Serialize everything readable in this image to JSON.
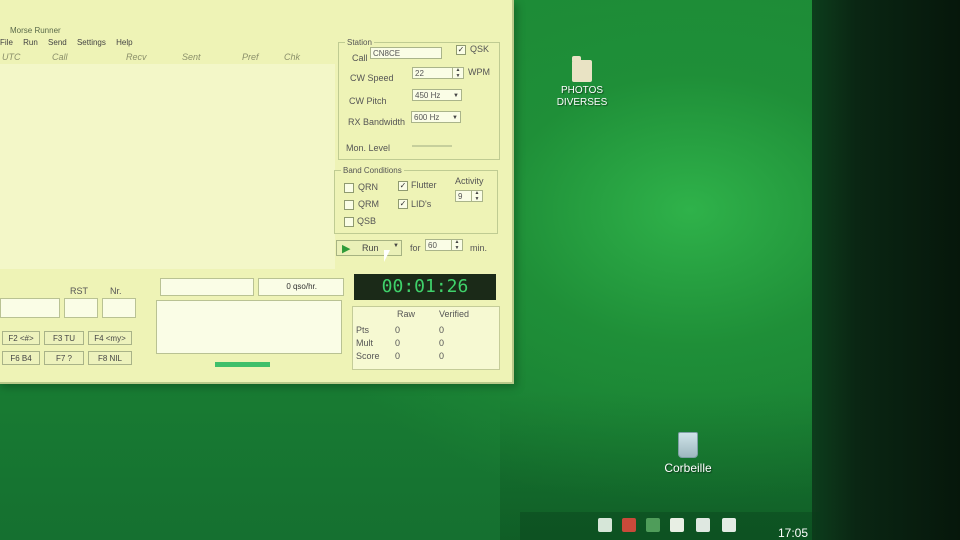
{
  "window": {
    "title": "Morse Runner"
  },
  "menu": [
    "File",
    "Run",
    "Send",
    "Settings",
    "Help"
  ],
  "log_columns": [
    "UTC",
    "Call",
    "Recv",
    "Sent",
    "Pref",
    "Chk"
  ],
  "station": {
    "legend": "Station",
    "call_label": "Call",
    "call_value": "CN8CE",
    "qsk_label": "QSK",
    "qsk_checked": true,
    "cw_speed_label": "CW Speed",
    "cw_speed_value": "22",
    "wpm_label": "WPM",
    "cw_pitch_label": "CW Pitch",
    "cw_pitch_value": "450 Hz",
    "rx_bw_label": "RX Bandwidth",
    "rx_bw_value": "600 Hz",
    "mon_level_label": "Mon. Level"
  },
  "band": {
    "legend": "Band Conditions",
    "qrn": "QRN",
    "qrm": "QRM",
    "qsb": "QSB",
    "flutter": "Flutter",
    "lids": "LID's",
    "activity_label": "Activity",
    "activity_value": "9"
  },
  "run": {
    "button": "Run",
    "for_label": "for",
    "minutes_value": "60",
    "min_label": "min."
  },
  "entry": {
    "rst_label": "RST",
    "nr_label": "Nr.",
    "rate": "0 qso/hr."
  },
  "fkeys": [
    "F2 <#>",
    "F3 TU",
    "F4 <my>",
    "F6 B4",
    "F7 ?",
    "F8 NIL"
  ],
  "timer": "00:01:26",
  "score": {
    "col_raw": "Raw",
    "col_verified": "Verified",
    "rows": [
      {
        "label": "Pts",
        "raw": "0",
        "verified": "0"
      },
      {
        "label": "Mult",
        "raw": "0",
        "verified": "0"
      },
      {
        "label": "Score",
        "raw": "0",
        "verified": "0"
      }
    ]
  },
  "desktop": {
    "folder_line1": "PHOTOS",
    "folder_line2": "DIVERSES",
    "bin_label": "Corbeille"
  },
  "taskbar": {
    "clock": "17:05"
  }
}
